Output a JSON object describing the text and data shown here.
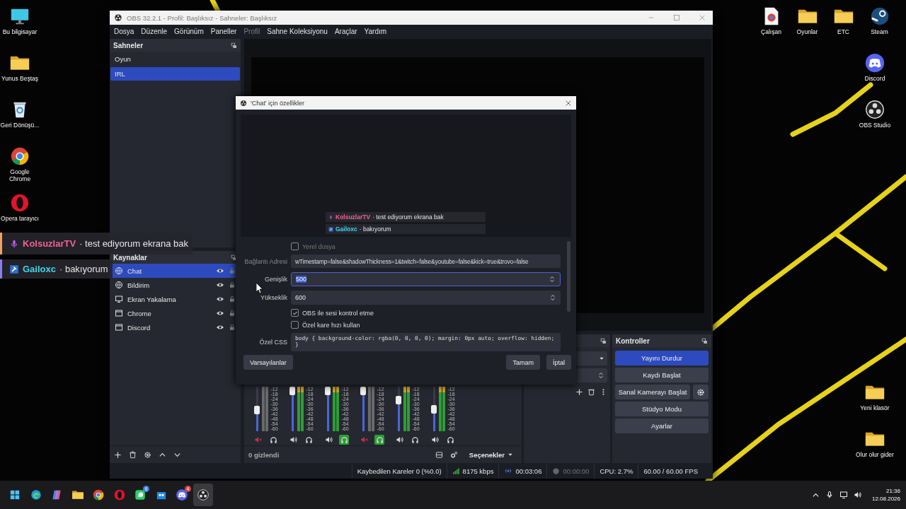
{
  "desktop": {
    "left_icons": [
      {
        "label": "Bu bilgisayar",
        "kind": "monitor"
      },
      {
        "label": "Yunus Beştaş",
        "kind": "folder"
      },
      {
        "label": "Geri Dönüşü...",
        "kind": "recycle"
      },
      {
        "label": "Google Chrome",
        "kind": "chrome"
      },
      {
        "label": "Opera tarayıcı",
        "kind": "opera"
      }
    ],
    "top_icons": [
      {
        "label": "Çalışan",
        "kind": "chrome-file"
      },
      {
        "label": "Oyunlar",
        "kind": "folder"
      },
      {
        "label": "ETC",
        "kind": "folder"
      },
      {
        "label": "Steam",
        "kind": "steam"
      }
    ],
    "right_icons": [
      {
        "label": "Discord",
        "kind": "discord"
      },
      {
        "label": "OBS Studio",
        "kind": "obs"
      }
    ],
    "bottom_icons": [
      {
        "label": "Yeni klasör",
        "kind": "folder"
      },
      {
        "label": "Olur olur gider",
        "kind": "folder"
      }
    ]
  },
  "chat_overlay": [
    {
      "user": "KolsuzlarTV",
      "message": "· test ediyorum ekrana bak",
      "color": "#f06292"
    },
    {
      "user": "Gailoxc",
      "message": "· bakıyorum",
      "color": "#3fd6e8"
    }
  ],
  "obs_window": {
    "title": "OBS 32.2.1 - Profil: Başlıksız - Sahneler: Başlıksız",
    "menu": [
      {
        "label": "Dosya",
        "disabled": false
      },
      {
        "label": "Düzenle",
        "disabled": false
      },
      {
        "label": "Görünüm",
        "disabled": false
      },
      {
        "label": "Paneller",
        "disabled": false
      },
      {
        "label": "Profil",
        "disabled": true
      },
      {
        "label": "Sahne Koleksiyonu",
        "disabled": false
      },
      {
        "label": "Araçlar",
        "disabled": false
      },
      {
        "label": "Yardım",
        "disabled": false
      }
    ],
    "scenes": {
      "title": "Sahneler",
      "items": [
        {
          "label": "Oyun",
          "selected": false
        },
        {
          "label": "IRL",
          "selected": true
        }
      ]
    },
    "sources": {
      "title": "Kaynaklar",
      "items": [
        {
          "label": "Chat",
          "kind": "browser",
          "selected": true
        },
        {
          "label": "Bildirim",
          "kind": "browser",
          "selected": false
        },
        {
          "label": "Ekran Yakalama",
          "kind": "display",
          "selected": false
        },
        {
          "label": "Chrome",
          "kind": "window",
          "selected": false
        },
        {
          "label": "Discord",
          "kind": "window",
          "selected": false
        }
      ]
    },
    "mixer": {
      "channels": [
        {
          "level": 0.47,
          "muted": true,
          "monitoring": false,
          "scale": [
            "-12",
            "-18",
            "-24",
            "-30",
            "-36",
            "-42",
            "-48",
            "-54",
            "-60"
          ]
        },
        {
          "level": 1,
          "muted": false,
          "monitoring": false,
          "scale": [
            "-12",
            "-18",
            "-24",
            "-30",
            "-36",
            "-42",
            "-48",
            "-54",
            "-60"
          ]
        },
        {
          "level": 1,
          "muted": false,
          "monitoring": true,
          "scale": [
            "-12",
            "-18",
            "-24",
            "-30",
            "-36",
            "-42",
            "-48",
            "-54",
            "-60"
          ]
        },
        {
          "level": 1,
          "muted": true,
          "monitoring": true,
          "scale": [
            "-12",
            "-18",
            "-24",
            "-30",
            "-36",
            "-42",
            "-48",
            "-54",
            "-60"
          ]
        },
        {
          "level": 0.7,
          "muted": false,
          "monitoring": false,
          "scale": [
            "-12",
            "-18",
            "-24",
            "-30",
            "-36",
            "-42",
            "-48",
            "-54",
            "-60"
          ]
        },
        {
          "level": 0.5,
          "muted": false,
          "monitoring": false,
          "scale": [
            "-12",
            "-18",
            "-24",
            "-30",
            "-36",
            "-42",
            "-48",
            "-54",
            "-60"
          ]
        }
      ],
      "hidden": "0 gizlendi",
      "options": "Seçenekler"
    },
    "controls": {
      "title": "Kontroller",
      "buttons": [
        {
          "label": "Yayını Durdur",
          "active": true
        },
        {
          "label": "Kaydı Başlat",
          "active": false
        },
        {
          "label": "Sanal Kamerayı Başlat",
          "active": false
        },
        {
          "label": "Stüdyo Modu",
          "active": false
        },
        {
          "label": "Ayarlar",
          "active": false
        }
      ]
    },
    "status_bar": {
      "dropped": "Kaybedilen Kareler 0 (%0.0)",
      "bitrate": "8175 kbps",
      "stream_time": "00:03:06",
      "record_time": "00:00:00",
      "cpu": "CPU: 2.7%",
      "fps": "60.00 / 60.00 FPS"
    }
  },
  "dialog": {
    "title": "'Chat' için özellikler",
    "preview_chat": [
      {
        "user": "KolsuzlarTV",
        "message": "· test ediyorum ekrana bak",
        "color": "#f06292"
      },
      {
        "user": "Gailoxc",
        "message": "· bakıyorum",
        "color": "#3fd6e8"
      }
    ],
    "local_file": {
      "label": "Yerel dosya",
      "checked": false
    },
    "url": {
      "label": "Bağlantı Adresi",
      "value": "wTimestamp=false&shadowThickness=1&twitch=false&youtube=false&kick=true&trovo=false"
    },
    "width": {
      "label": "Genişlik",
      "value": "500"
    },
    "height": {
      "label": "Yükseklik",
      "value": "600"
    },
    "checkboxes": [
      {
        "label": "OBS ile sesi kontrol etme",
        "checked": true
      },
      {
        "label": "Özel kare hızı kullan",
        "checked": false
      }
    ],
    "css": {
      "label": "Özel CSS",
      "value": "body { background-color: rgba(0, 0, 0, 0); margin: 0px auto; overflow: hidden;\n}"
    },
    "buttons": {
      "defaults": "Varsayılanlar",
      "ok": "Tamam",
      "cancel": "İptal"
    }
  },
  "taskbar": {
    "apps": [
      {
        "kind": "windows",
        "selected": false
      },
      {
        "kind": "edge",
        "selected": false
      },
      {
        "kind": "copilot",
        "selected": false
      },
      {
        "kind": "folder",
        "selected": false
      },
      {
        "kind": "chrome",
        "selected": false
      },
      {
        "kind": "opera",
        "selected": false
      },
      {
        "kind": "whatsapp",
        "badge": "6",
        "selected": false
      },
      {
        "kind": "store",
        "selected": false
      },
      {
        "kind": "discord",
        "badge": "4",
        "selected": false
      },
      {
        "kind": "obs",
        "selected": true
      }
    ],
    "time": "21:36",
    "date": "12.08.2026"
  }
}
